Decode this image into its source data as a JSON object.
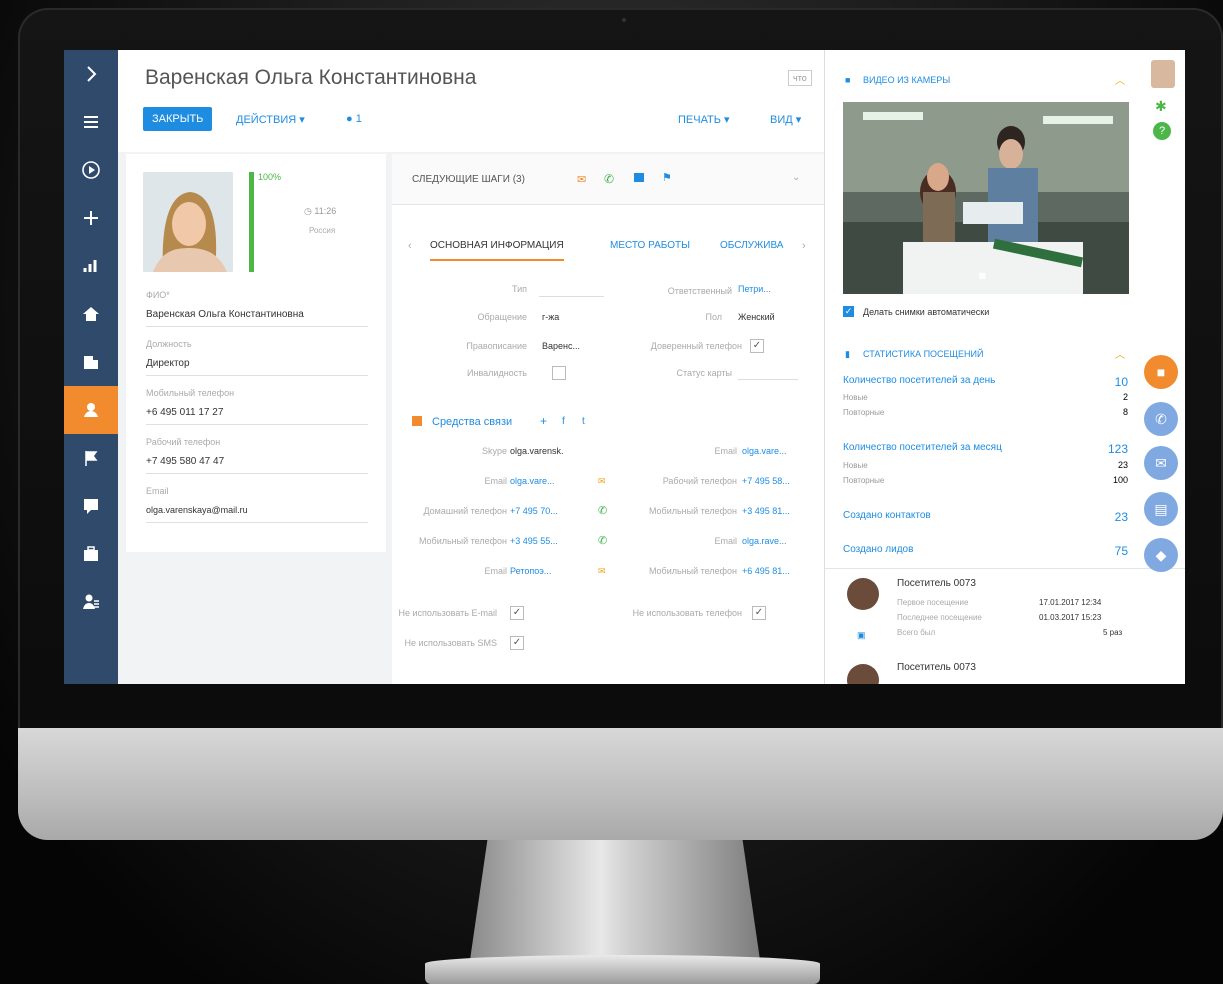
{
  "record": {
    "title": "Варенская Ольга Константиновна",
    "close_label": "ЗАКРЫТЬ",
    "actions_label": "ДЕЙСТВИЯ ▾",
    "tag_count": "1",
    "what_label": "что",
    "print_label": "ПЕЧАТЬ ▾",
    "view_label": "ВИД ▾"
  },
  "profile": {
    "completeness": "100%",
    "time": "11:26",
    "country": "Россия",
    "fio_label": "ФИО*",
    "fio_value": "Варенская Ольга Константиновна",
    "position_label": "Должность",
    "position_value": "Директор",
    "mobile_label": "Мобильный телефон",
    "mobile_value": "+6 495 011 17 27",
    "work_label": "Рабочий телефон",
    "work_value": "+7 495 580 47 47",
    "email_label": "Email",
    "email_value": "olga.varenskaya@mail.ru"
  },
  "next_steps": {
    "label": "СЛЕДУЮЩИЕ ШАГИ (3)"
  },
  "tabs": [
    "ОСНОВНАЯ ИНФОРМАЦИЯ",
    "МЕСТО РАБОТЫ",
    "ОБСЛУЖИВА"
  ],
  "general": {
    "type_label": "Тип",
    "owner_label": "Ответственный",
    "owner_value": "Петри...",
    "salutation_label": "Обращение",
    "salutation_value": "г-жа",
    "gender_label": "Пол",
    "gender_value": "Женский",
    "surname_label": "Правописание",
    "surname_value": "Варенс...",
    "trusted_phone_label": "Доверенный телефон",
    "disability_label": "Инвалидность",
    "card_status_label": "Статус карты"
  },
  "comms": {
    "header": "Средства связи",
    "rows_left": [
      {
        "label": "Skype",
        "value": "olga.varensk."
      },
      {
        "label": "Email",
        "value": "olga.vare..."
      },
      {
        "label": "Домашний телефон",
        "value": "+7 495 70..."
      },
      {
        "label": "Мобильный телефон",
        "value": "+3 495 55..."
      },
      {
        "label": "Email",
        "value": "Ретопоэ..."
      }
    ],
    "rows_right": [
      {
        "label": "Email",
        "value": "olga.vare..."
      },
      {
        "label": "Рабочий телефон",
        "value": "+7 495 58..."
      },
      {
        "label": "Мобильный телефон",
        "value": "+3 495 81..."
      },
      {
        "label": "Email",
        "value": "olga.rave..."
      },
      {
        "label": "Мобильный телефон",
        "value": "+6 495 81..."
      }
    ],
    "no_email": "Не использовать E-mail",
    "no_sms": "Не использовать SMS",
    "no_phone": "Не использовать телефон"
  },
  "camera": {
    "header": "ВИДЕО ИЗ КАМЕРЫ",
    "auto_snap": "Делать снимки автоматически"
  },
  "stats": {
    "header": "СТАТИСТИКА ПОСЕЩЕНИЙ",
    "per_day_label": "Количество посетителей за день",
    "per_day_value": "10",
    "new_label": "Новые",
    "new_day": "2",
    "repeat_label": "Повторные",
    "repeat_day": "8",
    "per_month_label": "Количество посетителей за месяц",
    "per_month_value": "123",
    "new_month": "23",
    "repeat_month": "100",
    "contacts_label": "Создано контактов",
    "contacts_value": "23",
    "leads_label": "Создано лидов",
    "leads_value": "75"
  },
  "visitor": {
    "name": "Посетитель 0073",
    "first_label": "Первое посещение",
    "first_value": "17.01.2017  12:34",
    "last_label": "Последнее посещение",
    "last_value": "01.03.2017  15:23",
    "total_label": "Всего был",
    "total_value": "5 раз"
  },
  "colors": {
    "sidebar": "#304a6b",
    "accent": "#1e8de1",
    "orange": "#f28a2e",
    "green": "#4cb648"
  }
}
